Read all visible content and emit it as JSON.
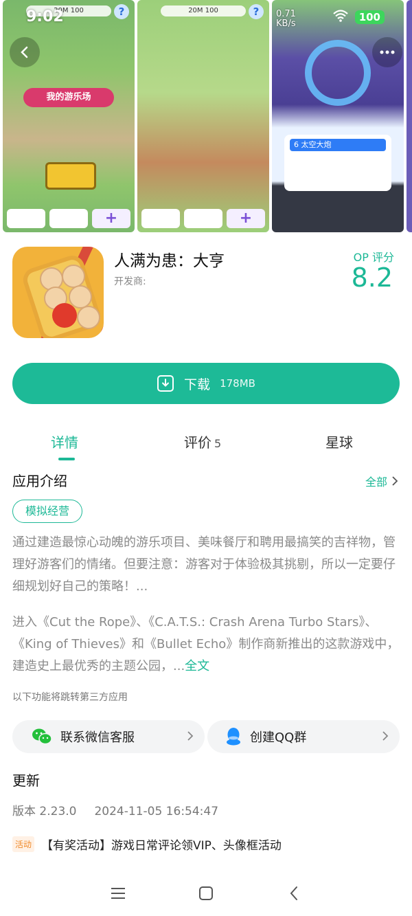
{
  "status_bar": {
    "time": "9:02",
    "net_speed_value": "0.71",
    "net_speed_unit": "KB/s",
    "battery": "100"
  },
  "screenshots": {
    "shot1_banner": "我的游乐场",
    "hud_text": "20M  100",
    "card_title": "6 太空大炮"
  },
  "app": {
    "name": "人满为患：大亨",
    "developer_label": "开发商:",
    "score_label": "OP 评分",
    "score": "8.2"
  },
  "download": {
    "label": "下载",
    "size": "178MB"
  },
  "tabs": [
    {
      "label": "详情",
      "count": ""
    },
    {
      "label": "评价",
      "count": "5"
    },
    {
      "label": "星球",
      "count": ""
    }
  ],
  "intro": {
    "title": "应用介绍",
    "all_label": "全部",
    "genre": "模拟经营",
    "para1": "通过建造最惊心动魄的游乐项目、美味餐厅和聘用最搞笑的吉祥物，管理好游客们的情绪。但要注意：游客对于体验极其挑剔，所以一定要仔细规划好自己的策略！...",
    "para2": "进入《Cut the Rope》、《C.A.T.S.: Crash Arena Turbo Stars》、《King of Thieves》和《Bullet Echo》制作商新推出的这款游戏中，建造史上最优秀的主题公园，...",
    "more": "全文",
    "third_party_note": "以下功能将跳转第三方应用"
  },
  "actions": {
    "wechat": "联系微信客服",
    "qq": "创建QQ群"
  },
  "update": {
    "title": "更新",
    "version": "版本 2.23.0",
    "date": "2024-11-05 16:54:47"
  },
  "promo": {
    "tag": "活动",
    "text": "【有奖活动】游戏日常评论领VIP、头像框活动"
  },
  "colors": {
    "accent": "#1cb896",
    "download_bg": "#1dba97"
  }
}
